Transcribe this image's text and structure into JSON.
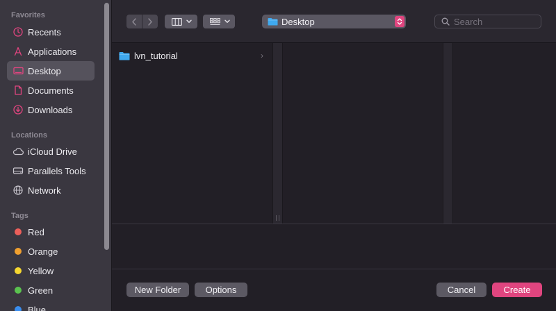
{
  "sidebar": {
    "favorites_heading": "Favorites",
    "favorites": [
      {
        "label": "Recents",
        "icon": "clock-icon"
      },
      {
        "label": "Applications",
        "icon": "applications-icon"
      },
      {
        "label": "Desktop",
        "icon": "desktop-icon",
        "selected": true
      },
      {
        "label": "Documents",
        "icon": "document-icon"
      },
      {
        "label": "Downloads",
        "icon": "download-icon"
      }
    ],
    "locations_heading": "Locations",
    "locations": [
      {
        "label": "iCloud Drive",
        "icon": "cloud-icon"
      },
      {
        "label": "Parallels Tools",
        "icon": "drive-icon"
      },
      {
        "label": "Network",
        "icon": "globe-icon"
      }
    ],
    "tags_heading": "Tags",
    "tags": [
      {
        "label": "Red",
        "color": "#ec5f5a"
      },
      {
        "label": "Orange",
        "color": "#f0a02f"
      },
      {
        "label": "Yellow",
        "color": "#f6d730"
      },
      {
        "label": "Green",
        "color": "#5ac24f"
      },
      {
        "label": "Blue",
        "color": "#3a8ef0"
      }
    ]
  },
  "toolbar": {
    "path_label": "Desktop",
    "search_placeholder": "Search"
  },
  "browser": {
    "items": [
      {
        "label": "lvn_tutorial",
        "icon": "folder-icon"
      }
    ]
  },
  "buttons": {
    "new_folder": "New Folder",
    "options": "Options",
    "cancel": "Cancel",
    "create": "Create"
  },
  "colors": {
    "accent": "#e0457f",
    "folder": "#3fa9ef"
  }
}
